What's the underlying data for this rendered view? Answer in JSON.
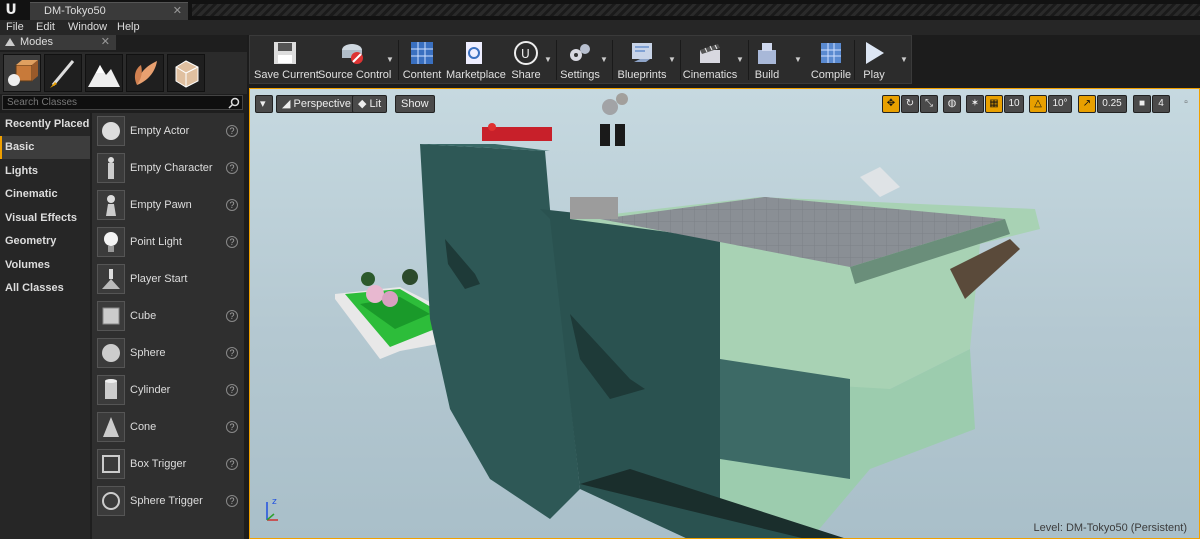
{
  "window": {
    "tab_title": "DM-Tokyo50",
    "logo": "U"
  },
  "menu": [
    "File",
    "Edit",
    "Window",
    "Help"
  ],
  "modes_panel": {
    "tab_label": "Modes",
    "mode_icons": [
      "place-icon",
      "paint-icon",
      "landscape-icon",
      "foliage-icon",
      "geometry-edit-icon"
    ],
    "search_placeholder": "Search Classes",
    "categories": [
      "Recently Placed",
      "Basic",
      "Lights",
      "Cinematic",
      "Visual Effects",
      "Geometry",
      "Volumes",
      "All Classes"
    ],
    "active_category": "Basic",
    "classes": [
      {
        "label": "Empty Actor",
        "icon": "empty-actor-icon"
      },
      {
        "label": "Empty Character",
        "icon": "empty-character-icon"
      },
      {
        "label": "Empty Pawn",
        "icon": "empty-pawn-icon"
      },
      {
        "label": "Point Light",
        "icon": "point-light-icon"
      },
      {
        "label": "Player Start",
        "icon": "player-start-icon"
      },
      {
        "label": "Cube",
        "icon": "cube-icon"
      },
      {
        "label": "Sphere",
        "icon": "sphere-icon"
      },
      {
        "label": "Cylinder",
        "icon": "cylinder-icon"
      },
      {
        "label": "Cone",
        "icon": "cone-icon"
      },
      {
        "label": "Box Trigger",
        "icon": "box-trigger-icon"
      },
      {
        "label": "Sphere Trigger",
        "icon": "sphere-trigger-icon"
      }
    ]
  },
  "toolbar": {
    "save_current": "Save Current",
    "source_control": "Source Control",
    "content": "Content",
    "marketplace": "Marketplace",
    "share": "Share",
    "settings": "Settings",
    "blueprints": "Blueprints",
    "cinematics": "Cinematics",
    "build": "Build",
    "compile": "Compile",
    "play": "Play"
  },
  "viewport": {
    "perspective": "Perspective",
    "lit": "Lit",
    "show": "Show",
    "grid_snap": "10",
    "rotation_snap": "10°",
    "scale_snap": "0.25",
    "camera_speed": "4",
    "level_prefix": "Level:",
    "level_name": "DM-Tokyo50 (Persistent)",
    "axis_z": "z"
  },
  "colors": {
    "accent": "#e8a000",
    "panel": "#2f2f2f",
    "sky": "#b8cbd3",
    "building": "#2f5a58",
    "building_light": "#a9d3b4"
  }
}
